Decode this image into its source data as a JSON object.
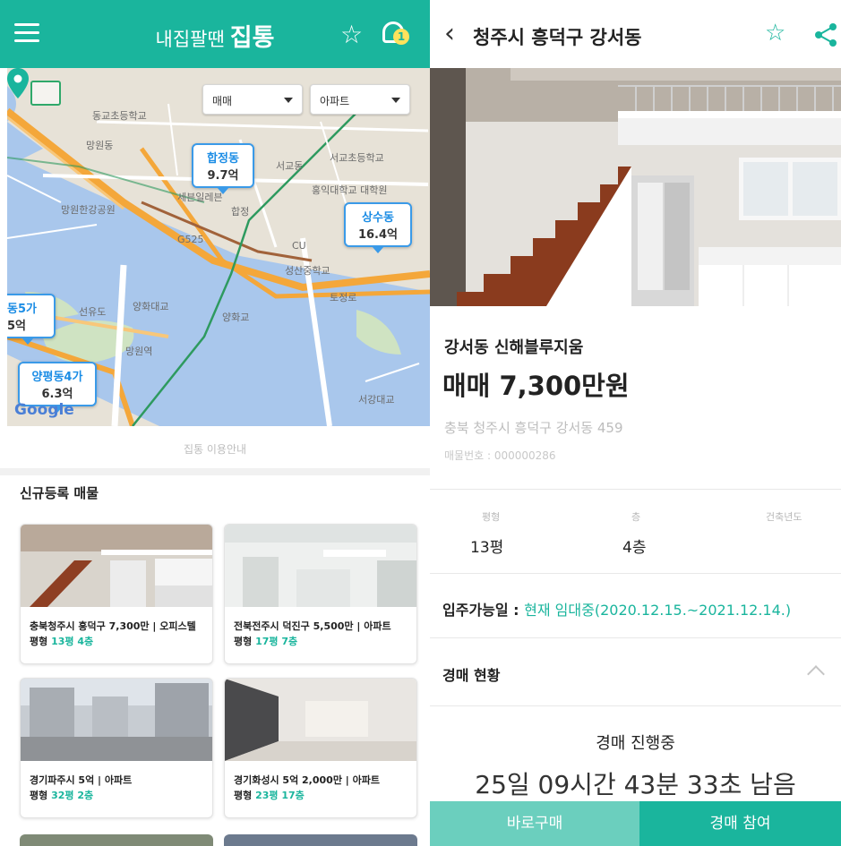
{
  "left_app": {
    "title_prefix": "내집팔땐",
    "title_main": "집통",
    "notification_count": "1",
    "map": {
      "filters": [
        {
          "label": "매매"
        },
        {
          "label": "아파트"
        }
      ],
      "price_bubbles": [
        {
          "name": "합정동",
          "price": "9.7억"
        },
        {
          "name": "상수동",
          "price": "16.4억"
        },
        {
          "name": "양평동4가",
          "price": "6.3억"
        },
        {
          "name": "동5가",
          "price": "5억"
        }
      ],
      "labels": [
        "동교초등학교",
        "망원동",
        "세븐일레븐",
        "서교동",
        "서교초등학교",
        "홍익대학교 대학원",
        "망원한강공원",
        "G525",
        "CU",
        "성산중학교",
        "선유도",
        "양화대교",
        "양화교",
        "합정",
        "망원역",
        "서강대교",
        "토정로"
      ],
      "google_logo": "Google",
      "caption": "집통 이용안내"
    },
    "section_title": "신규등록 매물",
    "cards": [
      {
        "line1": "충북청주시 흥덕구 7,300만 | 오피스텔",
        "line2_prefix": "평형",
        "size": "13평",
        "floor": "4층"
      },
      {
        "line1": "전북전주시 덕진구 5,500만 | 아파트",
        "line2_prefix": "평형",
        "size": "17평",
        "floor": "7층"
      },
      {
        "line1": "경기파주시 5억 | 아파트",
        "line2_prefix": "평형",
        "size": "32평",
        "floor": "2층"
      },
      {
        "line1": "경기화성시 5억 2,000만 | 아파트",
        "line2_prefix": "평형",
        "size": "23평",
        "floor": "17층"
      }
    ]
  },
  "right_app": {
    "title": "청주시 흥덕구 강서동",
    "photo_count": 5,
    "photo_active_index": 0,
    "listing_name": "강서동 신해블루지움",
    "price": "매매 7,300만원",
    "address": "충북 청주시 흥덕구 강서동 459",
    "listing_number": "매물번호 : 000000286",
    "stats": [
      {
        "label": "평형",
        "value": "13평"
      },
      {
        "label": "층",
        "value": "4층"
      },
      {
        "label": "건축년도",
        "value": ""
      }
    ],
    "move_in_label": "입주가능일 :",
    "move_in_value": "현재 임대중(2020.12.15.~2021.12.14.)",
    "auction_title": "경매 현황",
    "auction_status": "경매 진행중",
    "auction_remaining": "25일 09시간 43분 33초 남음",
    "buy_now_label": "바로구매",
    "auction_join_label": "경매 참여"
  },
  "colors": {
    "accent": "#1ab59d",
    "accent_light": "#6bcfbe",
    "bubble_border": "#3a9ae8"
  }
}
